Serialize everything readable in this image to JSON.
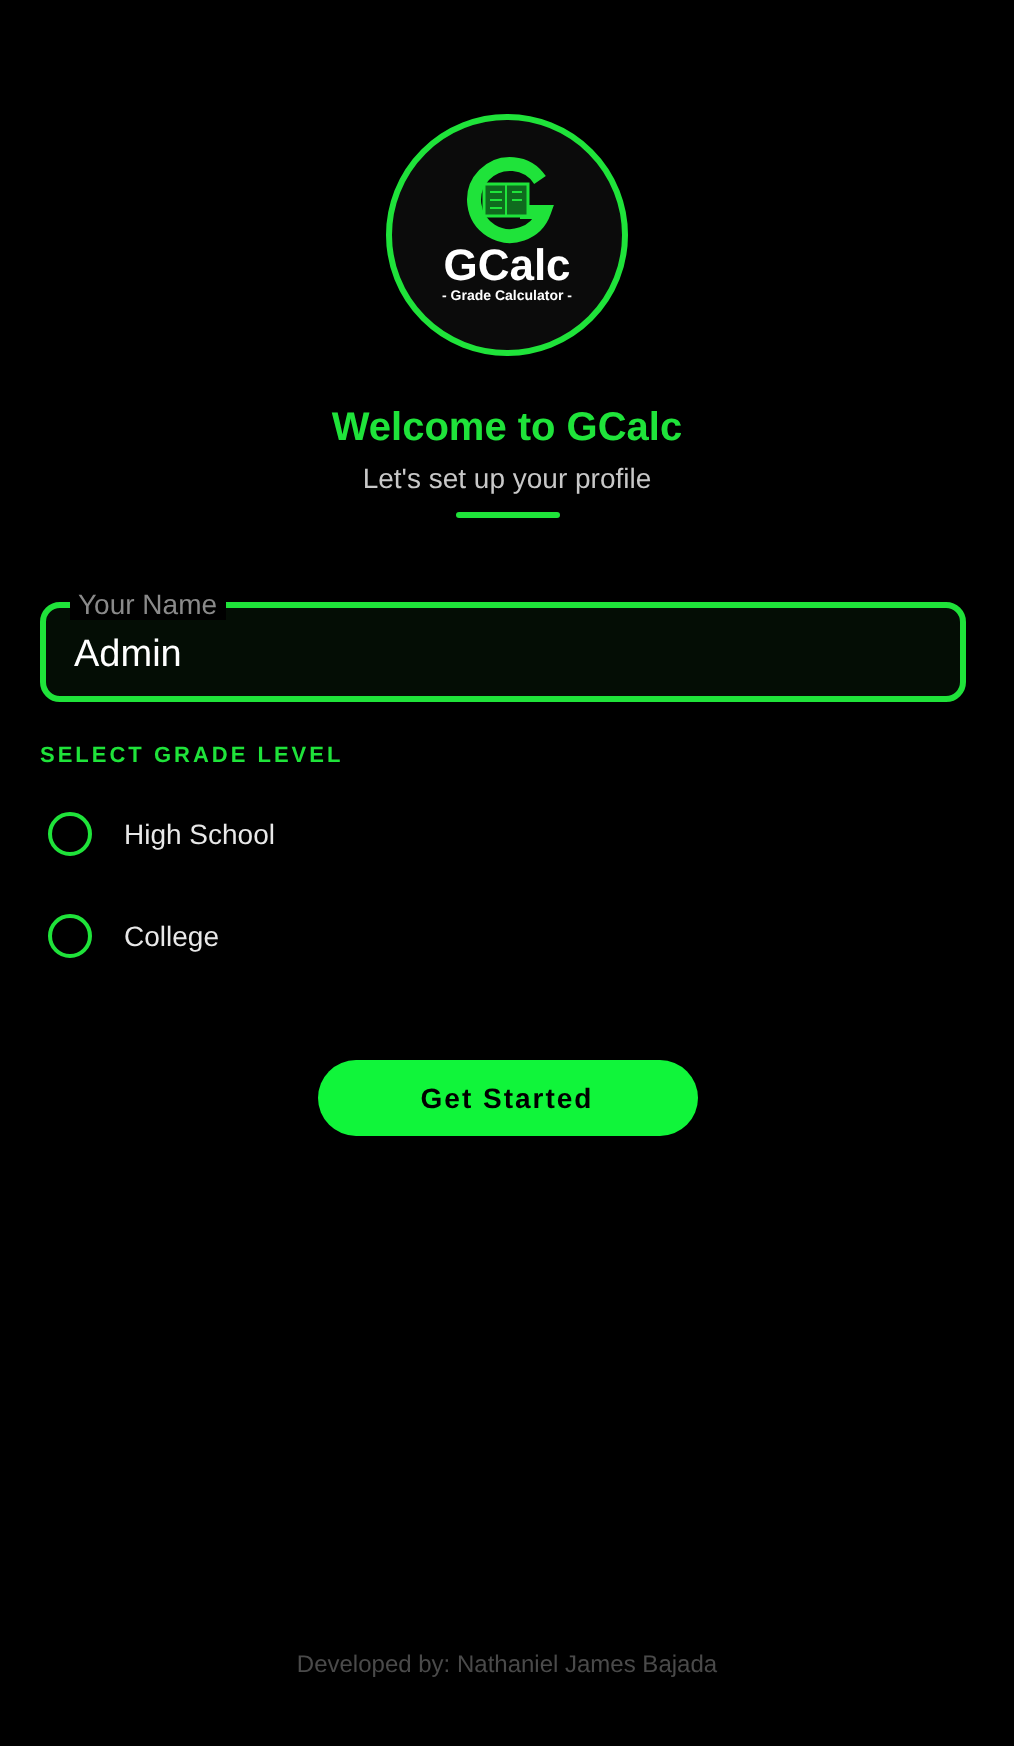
{
  "logo": {
    "title": "GCalc",
    "subtitle": "- Grade Calculator -"
  },
  "heading": "Welcome to GCalc",
  "subheading": "Let's set up your profile",
  "name_field": {
    "label": "Your Name",
    "value": "Admin"
  },
  "grade_section": {
    "label": "SELECT GRADE LEVEL",
    "options": [
      {
        "label": "High School",
        "selected": false
      },
      {
        "label": "College",
        "selected": false
      }
    ]
  },
  "button": "Get Started",
  "footer": "Developed by: Nathaniel James Bajada"
}
